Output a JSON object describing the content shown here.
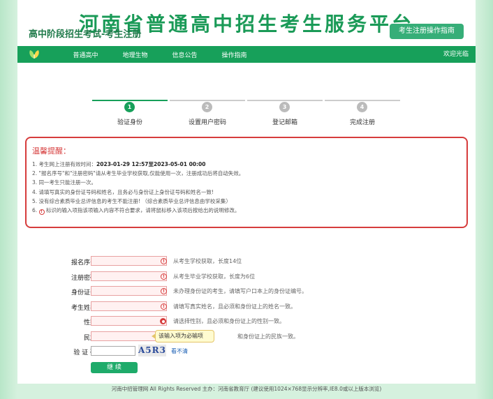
{
  "header": {
    "title": "河南省普通高中招生考生服务平台"
  },
  "nav": {
    "items": [
      "普通高中",
      "地理生物",
      "信息公告",
      "操作指南"
    ],
    "welcome": "欢迎光临"
  },
  "page": {
    "title": "高中阶段招生考试-考生注册",
    "guide_button": "考生注册操作指南"
  },
  "steps": [
    {
      "num": "1",
      "label": "验证身份",
      "active": true
    },
    {
      "num": "2",
      "label": "设置用户密码",
      "active": false
    },
    {
      "num": "3",
      "label": "登记邮箱",
      "active": false
    },
    {
      "num": "4",
      "label": "完成注册",
      "active": false
    }
  ],
  "notice": {
    "title": "温馨提醒：",
    "line1_prefix": "1. 考生网上注册有效时间：",
    "line1_time": "2023-01-29 12:57至2023-05-01 00:00",
    "line2": "2. \"报名序号\"和\"注册密码\"请从考生毕业学校获取,仅能使用一次，注册成功后将自动失效。",
    "line3": "3. 同一考生只能注册一次。",
    "line4": "4. 请填写真实的身份证号码和姓名，且务必与身份证上身份证号码和姓名一致!",
    "line5": "5. 没有综合素质毕业总评信息的考生不能注册!  （综合素质毕业总评信息由学校采集）",
    "line6_prefix": "6.",
    "line6_icon": "!",
    "line6_text": "标识的输入项指该项输入内容不符合要求，请将鼠标移入该项后按给出的说明修改。"
  },
  "form": {
    "fields": [
      {
        "label": "报名序号:",
        "hint": "从考生学校获取，长度14位",
        "type": "input"
      },
      {
        "label": "注册密码:",
        "hint": "从考生毕业学校获取，长度为6位",
        "type": "input"
      },
      {
        "label": "身份证号:",
        "hint": "未办理身份证的考生，请填写户口本上的身份证编号。",
        "type": "input"
      },
      {
        "label": "考生姓名:",
        "hint": "请填写真实姓名，且必须和身份证上的姓名一致。",
        "type": "input"
      },
      {
        "label": "性别:",
        "hint": "请选择性别，且必须和身份证上的性别一致。",
        "type": "select"
      },
      {
        "label": "民族:",
        "hint": "和身份证上的民族一致。",
        "type": "select"
      }
    ],
    "error_icon": "!",
    "captcha_label": "验 证 码:",
    "captcha_text": "A5R3",
    "captcha_refresh": "看不清",
    "tooltip": "该输入项为必输项",
    "submit": "继 续"
  },
  "footer": {
    "text": "河南中招管理网 All Rights Reserved 主办：河南省教育厅  (建议使用1024×768显示分辨率,IE8.0或以上版本浏览)"
  },
  "colors": {
    "brand": "#17a05a",
    "error": "#d63c3c",
    "accent": "#36ae78"
  }
}
